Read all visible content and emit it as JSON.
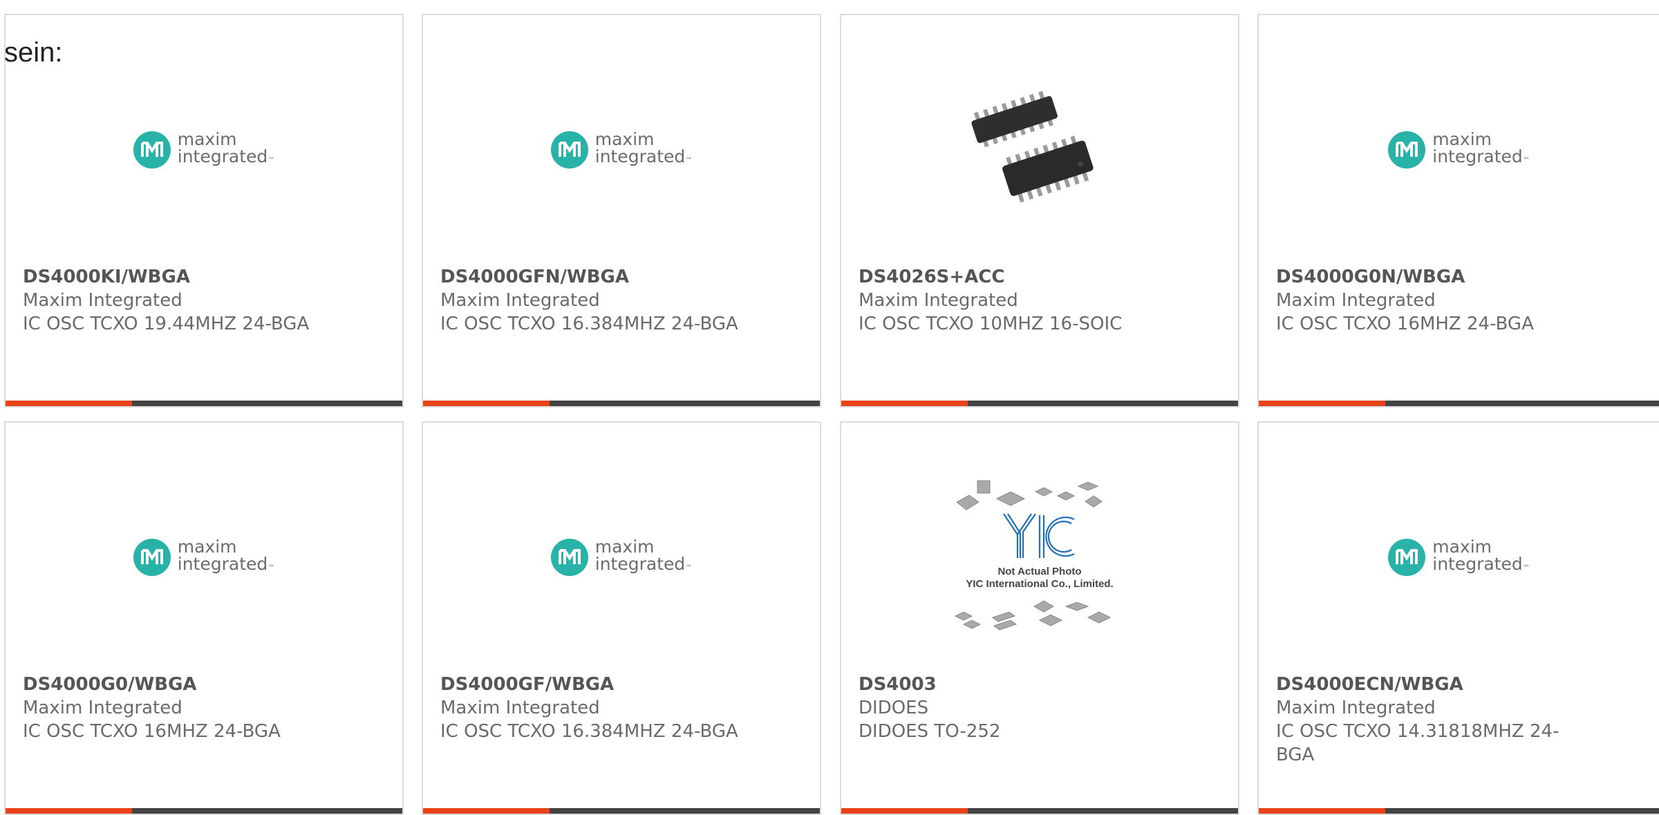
{
  "intro_text": "sein:",
  "colors": {
    "accent": "#e8431b",
    "bar_dark": "#444444",
    "card_border": "#dcdcdc",
    "logo_teal": "#29b3a8",
    "yic_blue": "#1f6fb8"
  },
  "cards": [
    {
      "part": "DS4000KI/WBGA",
      "maker": "Maxim Integrated",
      "desc": "IC OSC TCXO 19.44MHZ 24-BGA",
      "image": "maxim-logo"
    },
    {
      "part": "DS4000GFN/WBGA",
      "maker": "Maxim Integrated",
      "desc": "IC OSC TCXO 16.384MHZ 24-BGA",
      "image": "maxim-logo"
    },
    {
      "part": "DS4026S+ACC",
      "maker": "Maxim Integrated",
      "desc": "IC OSC TCXO 10MHZ 16-SOIC",
      "image": "soic-chip-photo"
    },
    {
      "part": "DS4000G0N/WBGA",
      "maker": "Maxim Integrated",
      "desc": "IC OSC TCXO 16MHZ 24-BGA",
      "image": "maxim-logo"
    },
    {
      "part": "DS4000G0/WBGA",
      "maker": "Maxim Integrated",
      "desc": "IC OSC TCXO 16MHZ 24-BGA",
      "image": "maxim-logo"
    },
    {
      "part": "DS4000GF/WBGA",
      "maker": "Maxim Integrated",
      "desc": "IC OSC TCXO 16.384MHZ 24-BGA",
      "image": "maxim-logo"
    },
    {
      "part": "DS4003",
      "maker": "DIDOES",
      "desc": "DIDOES TO-252",
      "image": "yic-placeholder"
    },
    {
      "part": "DS4000ECN/WBGA",
      "maker": "Maxim Integrated",
      "desc": "IC OSC TCXO 14.31818MHZ 24-BGA",
      "image": "maxim-logo"
    }
  ],
  "logo": {
    "line1": "maxim",
    "line2": "integrated",
    "tm": "™"
  },
  "placeholder": {
    "brand": "YIC",
    "line1": "Not Actual Photo",
    "line2": "YIC International Co., Limited."
  }
}
